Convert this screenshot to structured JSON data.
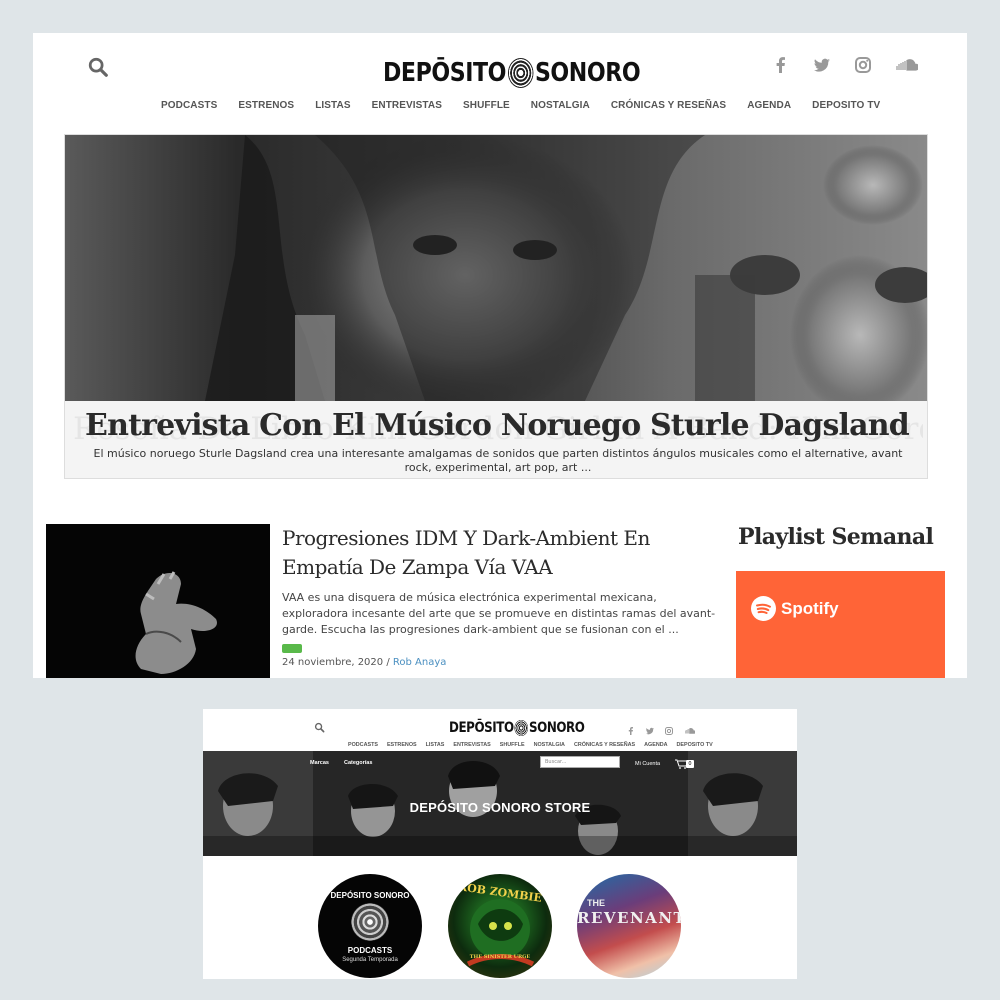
{
  "site": {
    "logo_left": "DEPŌSITO",
    "logo_right": "SONORO"
  },
  "social_icons": [
    "facebook-icon",
    "twitter-icon",
    "instagram-icon",
    "soundcloud-icon"
  ],
  "nav": {
    "items": [
      "PODCASTS",
      "ESTRENOS",
      "LISTAS",
      "ENTREVISTAS",
      "SHUFFLE",
      "NOSTALGIA",
      "CRÓNICAS Y RESEÑAS",
      "AGENDA",
      "DEPOSITO TV"
    ]
  },
  "hero": {
    "ghost_title": "Reseña De Libro Kim Gordon Girl In A Band: Kim Gordon Sonic Youth",
    "title": "Entrevista Con El Músico Noruego Sturle Dagsland",
    "excerpt": "El músico noruego Sturle Dagsland crea una interesante amalgamas de sonidos que parten distintos ángulos musicales como el alternative, avant rock, experimental, art pop, art ..."
  },
  "post": {
    "title": "Progresiones IDM Y Dark-Ambient En Empatía De Zampa Vía VAA",
    "excerpt": "VAA es una disquera de música electrónica experimental mexicana, exploradora incesante del arte que se promueve en distintas ramas del avant-garde. Escucha las progresiones dark-ambient que se fusionan con el ...",
    "date": "24 noviembre, 2020",
    "separator": " / ",
    "author": "Rob Anaya",
    "tag_color": "#59b94a"
  },
  "sidebar": {
    "title": "Playlist Semanal",
    "spotify_label": "Spotify",
    "spotify_color": "#ff6437"
  },
  "store": {
    "menu_brands": "Marcas",
    "menu_categories": "Categorías",
    "search_placeholder": "Buscar...",
    "account_label": "Mi Cuenta",
    "cart_count": "0",
    "banner_title": "DEPÓSITO SONORO STORE",
    "circles": {
      "podcasts_top": "DEPÓSITO SONORO",
      "podcasts_label": "PODCASTS",
      "podcasts_season": "Segunda Temporada",
      "zombie_title": "ROB ZOMBIE",
      "zombie_subtitle": "THE SINISTER URGE",
      "revenant_the": "THE",
      "revenant_title": "REVENANT"
    }
  }
}
